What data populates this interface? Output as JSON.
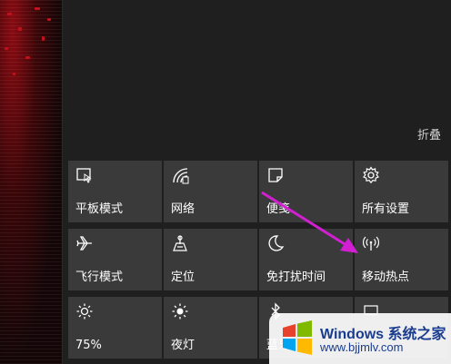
{
  "panel": {
    "collapse_label": "折叠"
  },
  "tiles": [
    {
      "label": "平板模式",
      "icon": "tablet-mode-icon"
    },
    {
      "label": "网络",
      "icon": "network-icon"
    },
    {
      "label": "便笺",
      "icon": "note-icon"
    },
    {
      "label": "所有设置",
      "icon": "gear-icon"
    },
    {
      "label": "飞行模式",
      "icon": "airplane-icon"
    },
    {
      "label": "定位",
      "icon": "location-icon"
    },
    {
      "label": "免打扰时间",
      "icon": "moon-icon"
    },
    {
      "label": "移动热点",
      "icon": "hotspot-icon"
    },
    {
      "label": "75%",
      "icon": "brightness-icon"
    },
    {
      "label": "夜灯",
      "icon": "night-light-icon"
    },
    {
      "label": "蓝牙",
      "icon": "bluetooth-icon"
    },
    {
      "label": "",
      "icon": "connect-icon"
    }
  ],
  "watermark": {
    "brand": "Windows 系统之家",
    "url": "www.bjjmlv.com"
  },
  "colors": {
    "tile_bg": "#3a3a3a",
    "panel_bg": "#1f1f1f",
    "arrow": "#d21fd2"
  }
}
